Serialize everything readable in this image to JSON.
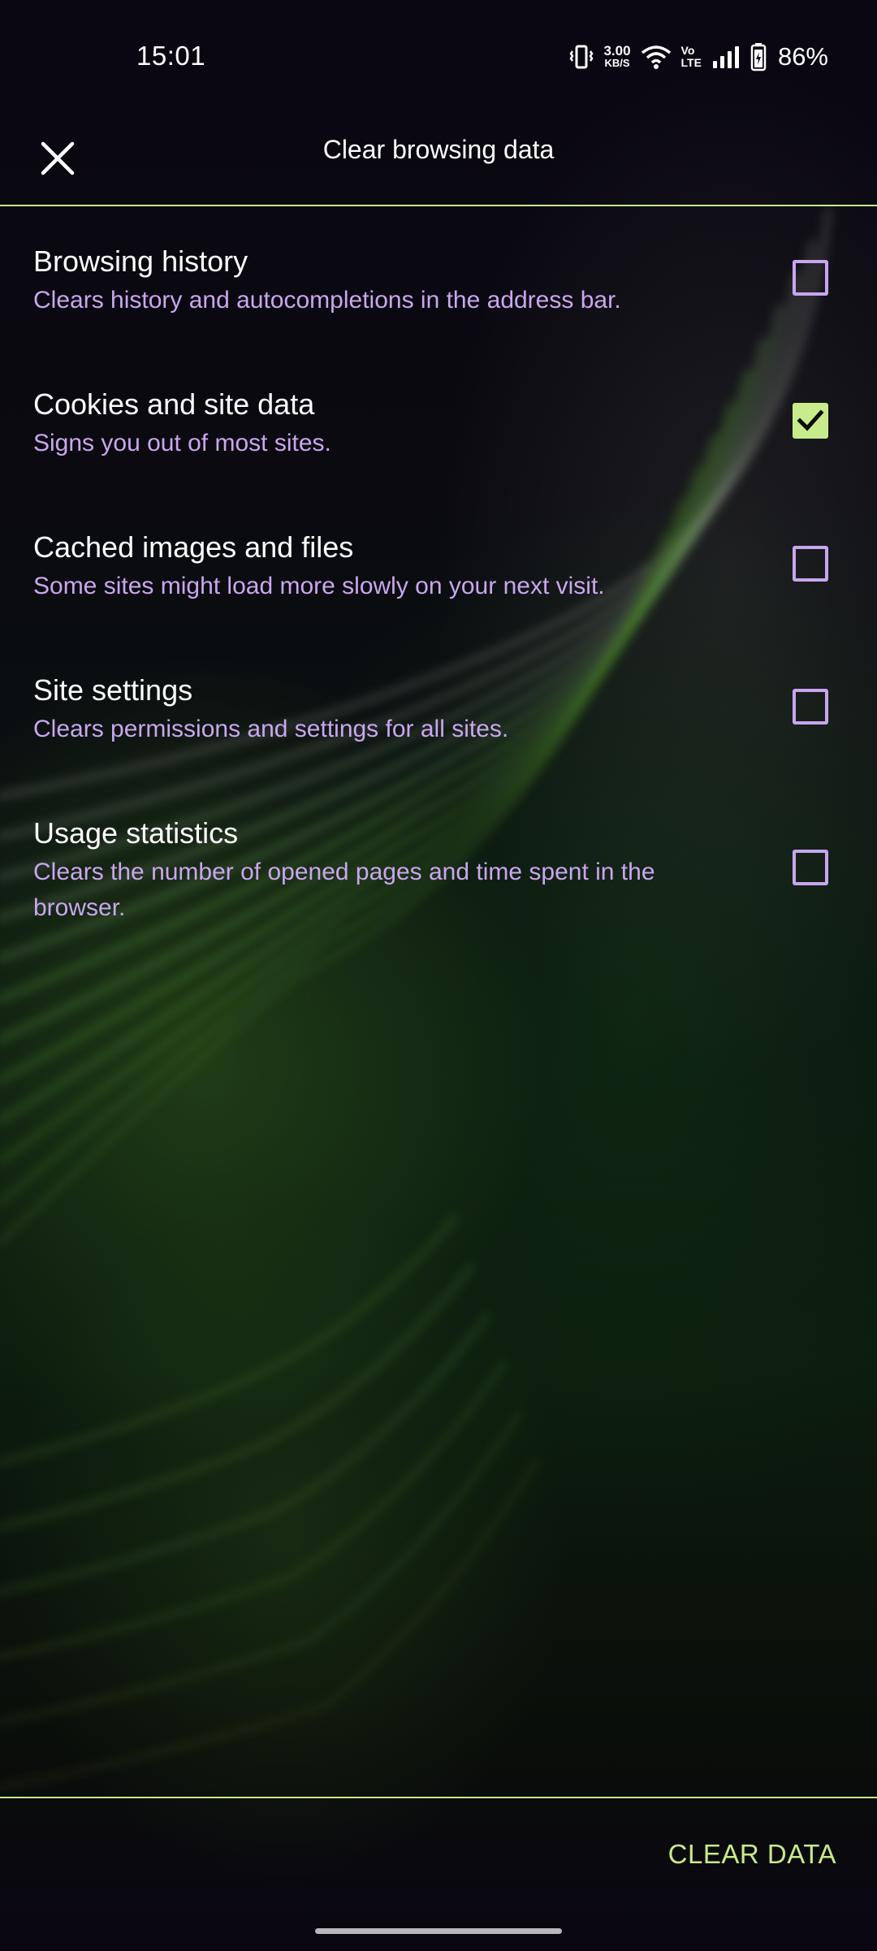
{
  "status_bar": {
    "time": "15:01",
    "net_speed_value": "3.00",
    "net_speed_unit": "KB/S",
    "volte_top": "Vo",
    "volte_bottom": "LTE",
    "battery_percent": "86%",
    "icons": [
      "vibrate-icon",
      "wifi-icon",
      "signal-icon",
      "battery-icon"
    ]
  },
  "header": {
    "title": "Clear browsing data",
    "close_icon": "close-icon"
  },
  "options": [
    {
      "title": "Browsing history",
      "description": "Clears history and autocompletions in the address bar.",
      "checked": false
    },
    {
      "title": "Cookies and site data",
      "description": "Signs you out of most sites.",
      "checked": true
    },
    {
      "title": "Cached images and files",
      "description": "Some sites might load more slowly on your next visit.",
      "checked": false
    },
    {
      "title": "Site settings",
      "description": "Clears permissions and settings for all sites.",
      "checked": false
    },
    {
      "title": "Usage statistics",
      "description": "Clears the number of opened pages and time spent in the browser.",
      "checked": false
    }
  ],
  "footer": {
    "clear_label": "CLEAR DATA"
  },
  "colors": {
    "accent": "#c7ea8a",
    "checkbox_border": "#c7a6ef",
    "description_text": "#caa6ee",
    "background": "#07040e"
  }
}
